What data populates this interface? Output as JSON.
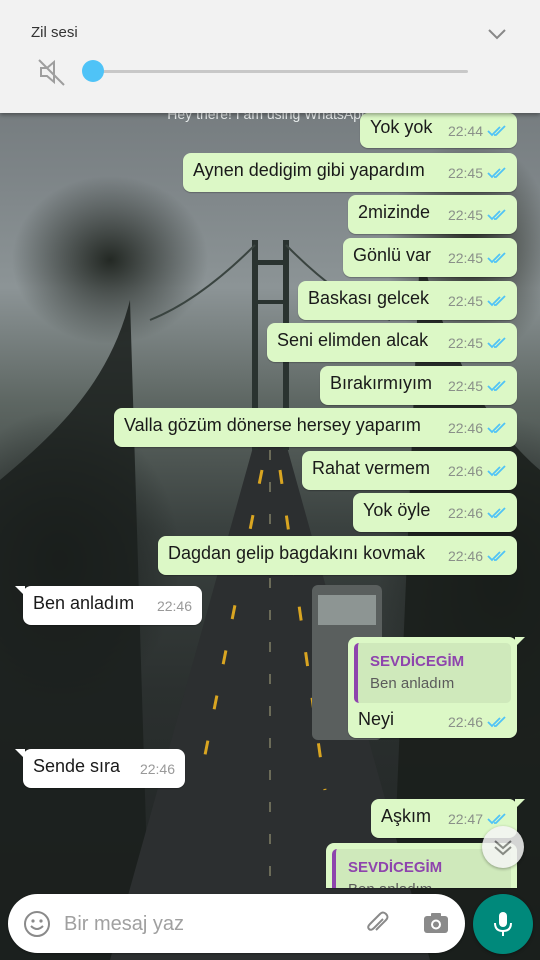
{
  "volume_panel": {
    "title": "Zil sesi",
    "level_fraction": 0.0,
    "muted": true,
    "accent_color": "#4fc3f7"
  },
  "chat": {
    "status_text": "Hey there! I am using WhatsApp.",
    "outgoing_color": "#dcf8c6",
    "incoming_color": "#ffffff",
    "tick_color": "#4fc3f7",
    "messages": [
      {
        "dir": "out",
        "text": "Yok yok",
        "time": "22:44",
        "status": "read"
      },
      {
        "dir": "out",
        "text": "Aynen dedigim gibi yapardım",
        "time": "22:45",
        "status": "read"
      },
      {
        "dir": "out",
        "text": "2mizinde",
        "time": "22:45",
        "status": "read"
      },
      {
        "dir": "out",
        "text": "Gönlü var",
        "time": "22:45",
        "status": "read"
      },
      {
        "dir": "out",
        "text": "Baskası gelcek",
        "time": "22:45",
        "status": "read"
      },
      {
        "dir": "out",
        "text": "Seni elimden alcak",
        "time": "22:45",
        "status": "read"
      },
      {
        "dir": "out",
        "text": "Bırakırmıyım",
        "time": "22:45",
        "status": "read"
      },
      {
        "dir": "out",
        "text": "Valla gözüm dönerse hersey yaparım",
        "time": "22:46",
        "status": "read"
      },
      {
        "dir": "out",
        "text": "Rahat vermem",
        "time": "22:46",
        "status": "read"
      },
      {
        "dir": "out",
        "text": "Yok öyle",
        "time": "22:46",
        "status": "read"
      },
      {
        "dir": "out",
        "text": "Dagdan gelip bagdakını kovmak",
        "time": "22:46",
        "status": "read"
      },
      {
        "dir": "in",
        "text": "Ben anladım",
        "time": "22:46"
      },
      {
        "dir": "out",
        "text": "Neyi",
        "time": "22:46",
        "status": "read",
        "quote": {
          "name": "SEVDİCEGİM",
          "text": "Ben anladım"
        }
      },
      {
        "dir": "in",
        "text": "Sende sıra",
        "time": "22:46"
      },
      {
        "dir": "out",
        "text": "Aşkım",
        "time": "22:47",
        "status": "read"
      },
      {
        "dir": "out",
        "text": "",
        "time": "",
        "quote": {
          "name": "SEVDİCEGİM",
          "text": "Ben anladım"
        }
      }
    ]
  },
  "composer": {
    "placeholder": "Bir mesaj yaz",
    "emoji_icon": "emoji-icon",
    "attach_icon": "paperclip-icon",
    "camera_icon": "camera-icon",
    "send_icon": "mic-icon",
    "send_color": "#00897b"
  },
  "scroll_down_icon": "double-chevron-down-icon"
}
